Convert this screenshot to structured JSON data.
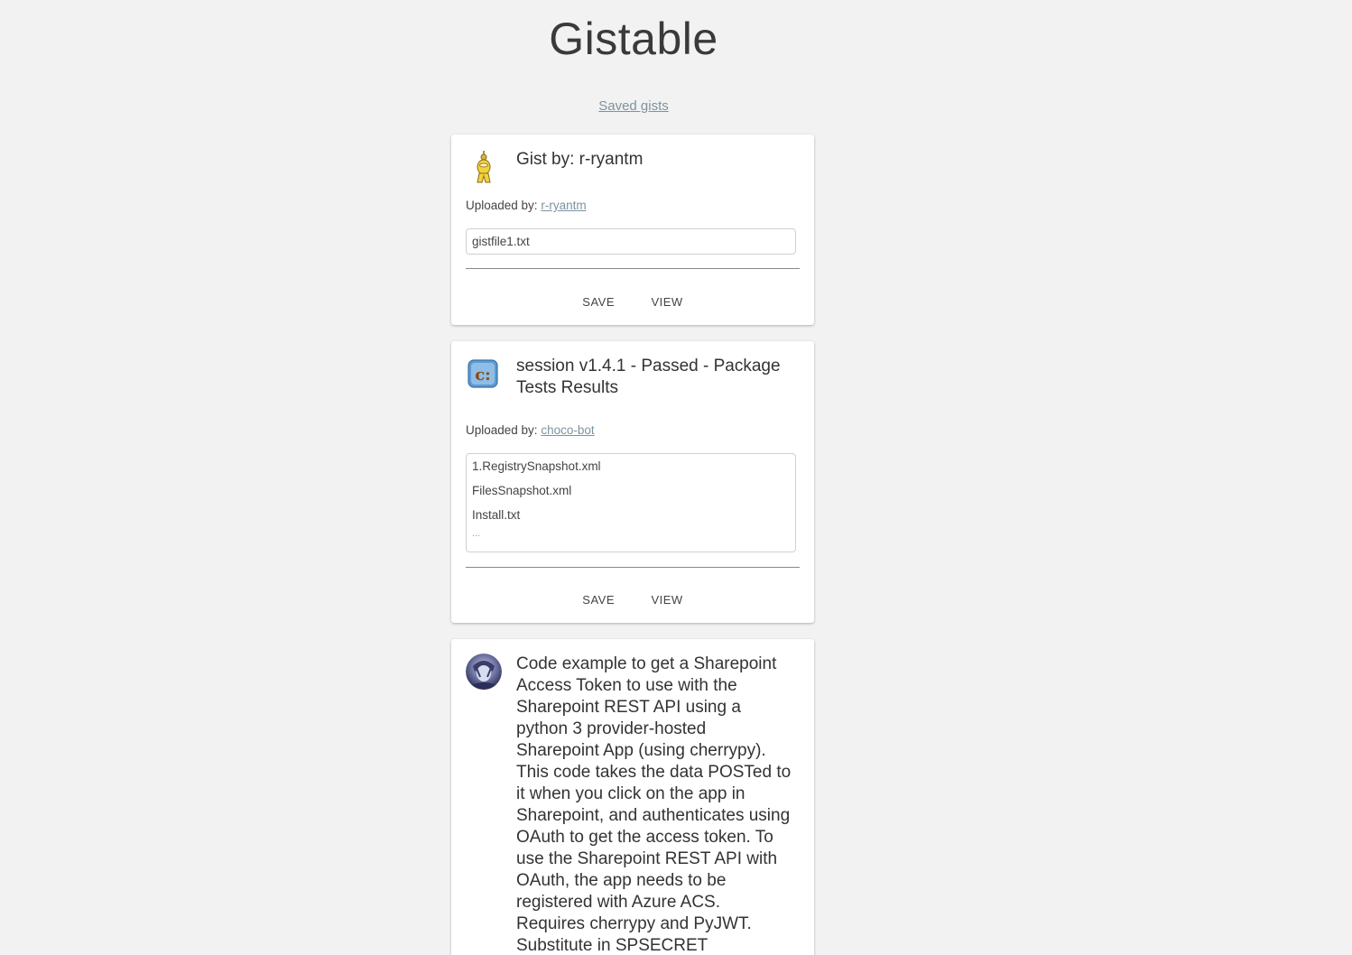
{
  "app": {
    "title": "Gistable",
    "saved_link": "Saved gists"
  },
  "gists": [
    {
      "title": "Gist by: r-ryantm",
      "uploaded_label": "Uploaded by:",
      "uploader": "r-ryantm",
      "avatar_icon": "robot-figure-icon",
      "files": [
        "gistfile1.txt"
      ],
      "more": "",
      "save_label": "SAVE",
      "view_label": "VIEW"
    },
    {
      "title": "session v1.4.1 - Passed - Package Tests Results",
      "uploaded_label": "Uploaded by:",
      "uploader": "choco-bot",
      "avatar_icon": "chocolatey-logo-icon",
      "files": [
        "1.RegistrySnapshot.xml",
        "FilesSnapshot.xml",
        "Install.txt"
      ],
      "more": "...",
      "save_label": "SAVE",
      "view_label": "VIEW"
    },
    {
      "title": "Code example to get a Sharepoint Access Token to use with the Sharepoint REST API using a python 3 provider-hosted Sharepoint App (using cherrypy). This code takes the data POSTed to it when you click on the app in Sharepoint, and authenticates using OAuth to get the access token. To use the Sharepoint REST API with OAuth, the app needs to be registered with Azure ACS. Requires cherrypy and PyJWT. Substitute in SPSECRET",
      "avatar_icon": "user-photo-avatar-icon"
    }
  ],
  "colors": {
    "background": "#f2f2f2",
    "link": "#7b94a0",
    "card": "#ffffff"
  }
}
